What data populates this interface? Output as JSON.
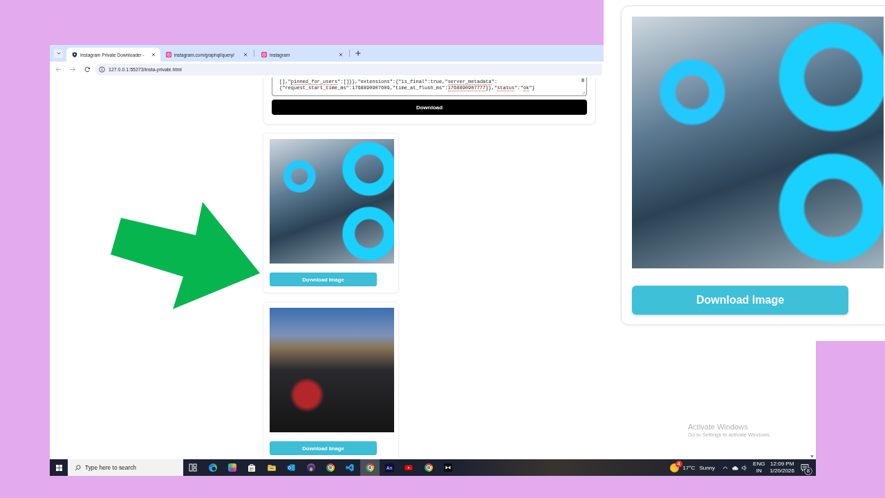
{
  "browser": {
    "tabs": [
      {
        "kind": "page",
        "title": "Instagram Private Downloader -",
        "selected": true
      },
      {
        "kind": "instagram",
        "title": "instagram.com/graphql/query/",
        "selected": false
      },
      {
        "kind": "instagram",
        "title": "Instagram",
        "selected": false
      }
    ],
    "address": "127.0.0.1:55273/insta-private.html"
  },
  "response_box": {
    "lines": [
      [
        {
          "text": "[],\"",
          "misspelled": false
        },
        {
          "text": "pinned_for_users",
          "misspelled": true
        },
        {
          "text": "\":[]}},\"extensions\":{\"is_final\":true,\"",
          "misspelled": false
        },
        {
          "text": "server_metadata",
          "misspelled": true
        },
        {
          "text": "\":",
          "misspelled": false
        }
      ],
      [
        {
          "text": "{\"request_start_time_ms\":1768890907609,\"time_at_flush_ms\":",
          "misspelled": false
        },
        {
          "text": "1768890907777",
          "misspelled": true
        },
        {
          "text": "}},\"",
          "misspelled": false
        },
        {
          "text": "status",
          "misspelled": true
        },
        {
          "text": "\":\"",
          "misspelled": false
        },
        {
          "text": "ok",
          "misspelled": true
        },
        {
          "text": "\"}",
          "misspelled": false
        }
      ]
    ],
    "button": "Download"
  },
  "results": [
    {
      "button": "Download Image"
    },
    {
      "button": "Download Image"
    }
  ],
  "zoom_card": {
    "button": "Download Image"
  },
  "os_notice": {
    "title": "Activate Windows",
    "subtitle": "Go to Settings to activate Windows."
  },
  "taskbar": {
    "search": {
      "placeholder": "Type here to search"
    },
    "apps": [
      {
        "kind": "task-view",
        "selected": false
      },
      {
        "kind": "edge",
        "selected": false
      },
      {
        "kind": "copilot",
        "selected": false
      },
      {
        "kind": "store",
        "selected": false
      },
      {
        "kind": "explorer",
        "selected": false
      },
      {
        "kind": "outlook",
        "selected": false
      },
      {
        "kind": "orb",
        "selected": false
      },
      {
        "kind": "chrome",
        "selected": false
      },
      {
        "kind": "vscode",
        "selected": false
      },
      {
        "kind": "chrome",
        "selected": true
      },
      {
        "kind": "tile",
        "label": "An",
        "selected": false
      },
      {
        "kind": "youtube",
        "selected": false
      },
      {
        "kind": "chrome",
        "selected": false
      },
      {
        "kind": "media",
        "selected": false
      }
    ],
    "weather": {
      "badge": "4",
      "temp": "17°C",
      "condition": "Sunny"
    },
    "language": {
      "lang": "ENG",
      "region": "IN"
    },
    "clock": {
      "time": "12:09 PM",
      "date": "1/20/2026"
    },
    "notifications": {
      "count": "8"
    }
  }
}
